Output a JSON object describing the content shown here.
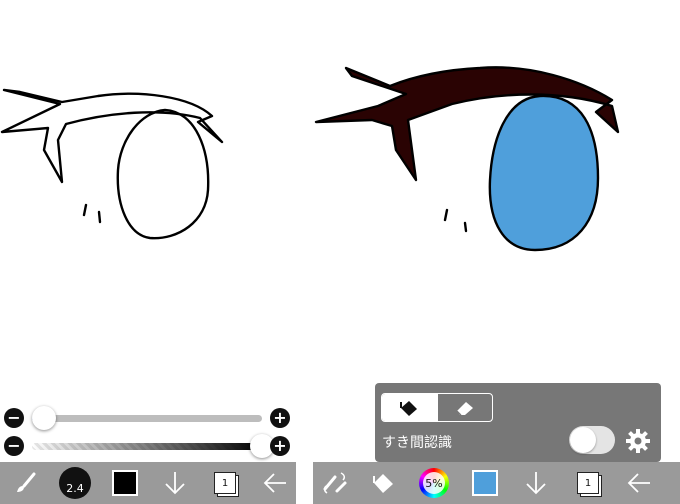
{
  "left_panel": {
    "brush_size_slider": {
      "value_fraction": 0.05,
      "minus_icon": "minus-circle-icon",
      "plus_icon": "plus-circle-icon"
    },
    "opacity_slider": {
      "value_fraction": 1.0,
      "minus_icon": "minus-circle-icon",
      "plus_icon": "plus-circle-icon"
    },
    "toolbar": {
      "tool_icon": "brush-icon",
      "brush_size_label": "2.4",
      "color": "#000000",
      "down_icon": "arrow-down-icon",
      "layer_number": "1",
      "back_icon": "arrow-left-icon"
    }
  },
  "right_panel": {
    "popup": {
      "modes": [
        {
          "icon": "fill-bucket-icon",
          "active": true
        },
        {
          "icon": "eraser-icon",
          "active": false
        }
      ],
      "gap_label": "すき間認識",
      "gap_toggle_on": false,
      "settings_icon": "gear-icon"
    },
    "toolbar": {
      "transform_icon": "transform-swap-icon",
      "tool_icon": "fill-bucket-icon",
      "color_wheel_label": "5%",
      "color": "#4f9fdb",
      "down_icon": "arrow-down-icon",
      "layer_number": "1",
      "back_icon": "arrow-left-icon"
    }
  },
  "colors": {
    "toolbar_bg": "#9a9a9a",
    "popup_bg": "#777777",
    "eye_fill": "#4f9fdb",
    "lash_fill": "#2a0303",
    "accent": "#3c6fd6"
  }
}
